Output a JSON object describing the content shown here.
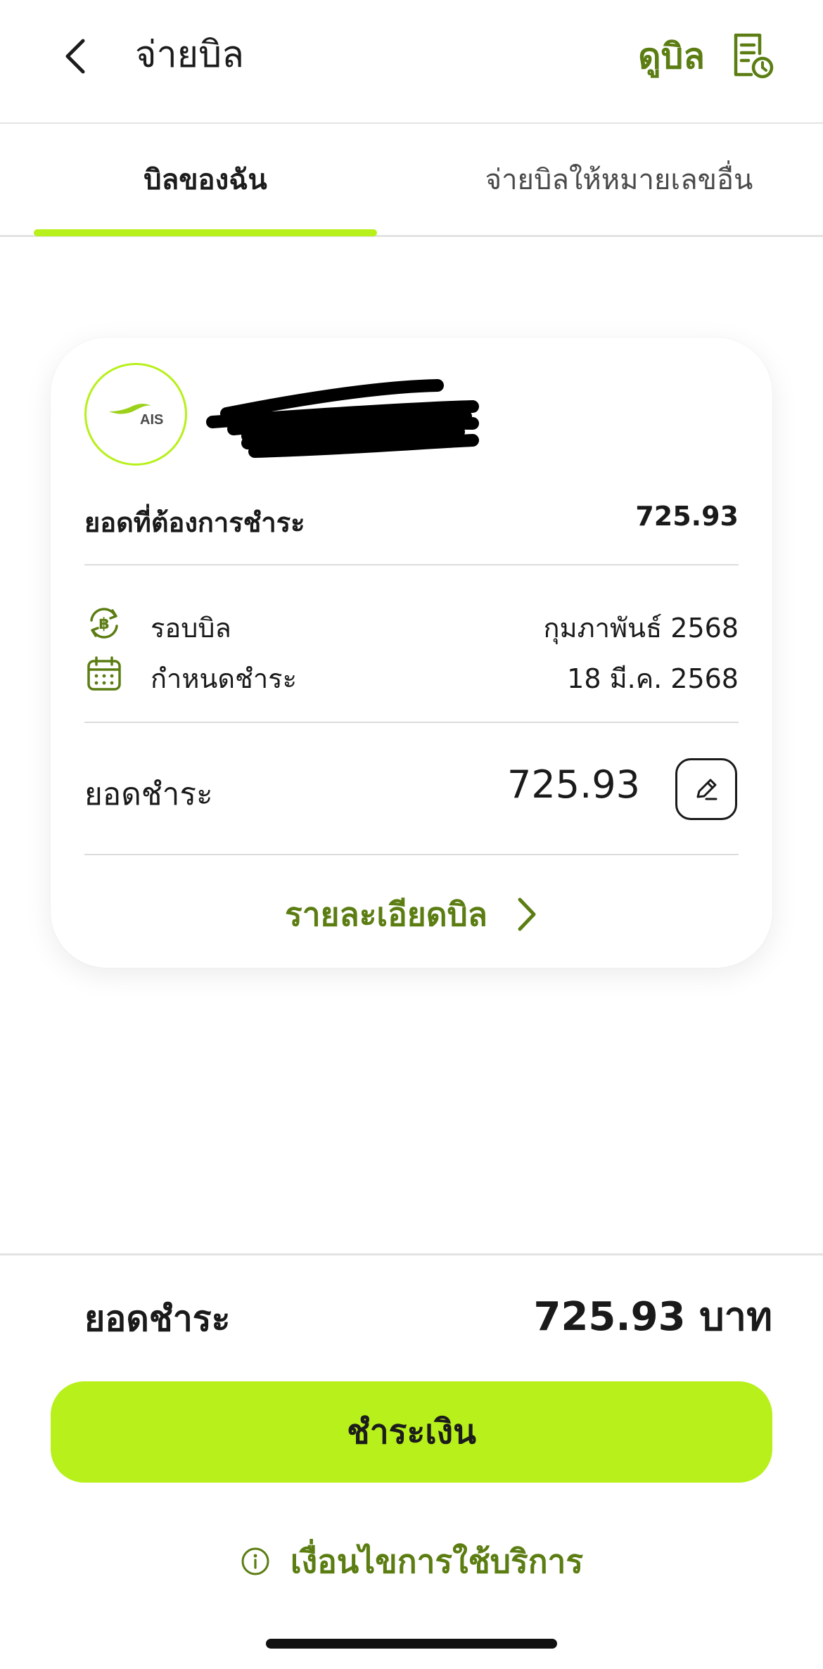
{
  "header": {
    "title": "จ่ายบิล",
    "view_bill_label": "ดูบิล"
  },
  "tabs": [
    {
      "label": "บิลของฉัน",
      "active": true
    },
    {
      "label": "จ่ายบิลให้หมายเลขอื่น",
      "active": false
    }
  ],
  "bill_card": {
    "logo_text": "AIS",
    "amount_due_label": "ยอดที่ต้องการชำระ",
    "amount_due_value": "725.93",
    "billing_cycle_label": "รอบบิล",
    "billing_cycle_value": "กุมภาพันธ์ 2568",
    "due_date_label": "กำหนดชำระ",
    "due_date_value": "18 มี.ค. 2568",
    "payment_label": "ยอดชำระ",
    "payment_value": "725.93",
    "detail_link_label": "รายละเอียดบิล"
  },
  "footer": {
    "total_label": "ยอดชำระ",
    "total_value": "725.93 บาท",
    "pay_button_label": "ชำระเงิน",
    "terms_label": "เงื่อนไขการใช้บริการ"
  },
  "colors": {
    "accent": "#b7f01a",
    "brand_text": "#5b7d12"
  },
  "icons": [
    "back-icon",
    "bill-history-icon",
    "baht-cycle-icon",
    "calendar-icon",
    "edit-pencil-icon",
    "chevron-right-icon",
    "info-icon"
  ]
}
